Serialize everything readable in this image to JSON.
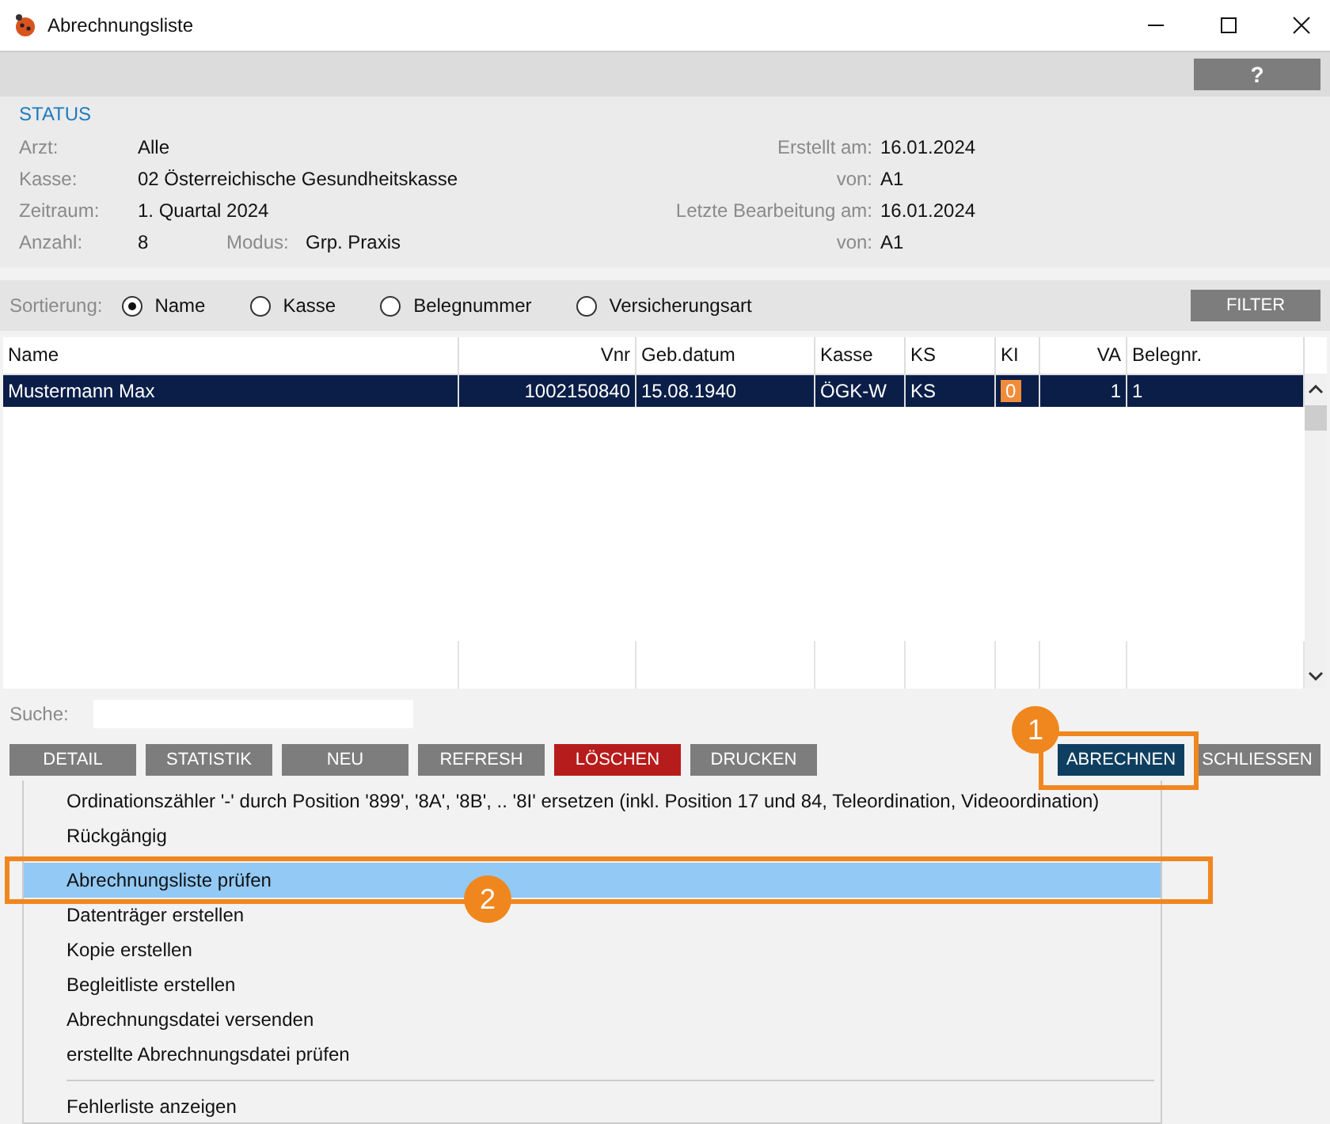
{
  "window": {
    "title": "Abrechnungsliste"
  },
  "help_button": "?",
  "status": {
    "heading": "STATUS",
    "rows": [
      {
        "label": "Arzt:",
        "value": "Alle",
        "right_label": "Erstellt am:",
        "right_value": "16.01.2024"
      },
      {
        "label": "Kasse:",
        "value": "02  Österreichische Gesundheitskasse",
        "right_label": "von:",
        "right_value": "A1"
      },
      {
        "label": "Zeitraum:",
        "value": "1. Quartal 2024",
        "right_label": "Letzte Bearbeitung am:",
        "right_value": "16.01.2024"
      },
      {
        "label": "Anzahl:",
        "value": "8",
        "extra_label": "Modus:",
        "extra_value": "Grp. Praxis",
        "right_label": "von:",
        "right_value": "A1"
      }
    ]
  },
  "sorting": {
    "label": "Sortierung:",
    "options": [
      {
        "label": "Name",
        "selected": true
      },
      {
        "label": "Kasse",
        "selected": false
      },
      {
        "label": "Belegnummer",
        "selected": false
      },
      {
        "label": "Versicherungsart",
        "selected": false
      }
    ]
  },
  "filter_button": "FILTER",
  "table": {
    "columns": [
      {
        "label": "Name",
        "kind": "text"
      },
      {
        "label": "Vnr",
        "kind": "number"
      },
      {
        "label": "Geb.datum",
        "kind": "text"
      },
      {
        "label": "Kasse",
        "kind": "text"
      },
      {
        "label": "KS",
        "kind": "text"
      },
      {
        "label": "KI",
        "kind": "badge"
      },
      {
        "label": "VA",
        "kind": "number"
      },
      {
        "label": "Belegnr.",
        "kind": "text"
      }
    ],
    "rows": [
      {
        "selected": true,
        "cells": [
          "Mustermann Max",
          "1002150840",
          "15.08.1940",
          "ÖGK-W",
          "KS",
          "0",
          "1",
          "1"
        ]
      }
    ]
  },
  "search": {
    "label": "Suche:"
  },
  "buttons": [
    {
      "label": "DETAIL",
      "kind": "normal"
    },
    {
      "label": "STATISTIK",
      "kind": "normal"
    },
    {
      "label": "NEU",
      "kind": "normal"
    },
    {
      "label": "REFRESH",
      "kind": "normal"
    },
    {
      "label": "LÖSCHEN",
      "kind": "danger"
    },
    {
      "label": "DRUCKEN",
      "kind": "normal"
    }
  ],
  "right_buttons": [
    {
      "label": "ABRECHNEN",
      "kind": "primary"
    },
    {
      "label": "SCHLIESSEN",
      "kind": "normal"
    }
  ],
  "menu": {
    "groups": [
      [
        {
          "label": "Ordinationszähler '-' durch Position '899', '8A', '8B', .. '8I' ersetzen  (inkl. Position 17 und 84, Teleordination, Videoordination)",
          "selected": false
        },
        {
          "label": "Rückgängig",
          "selected": false
        }
      ],
      [
        {
          "label": "Abrechnungsliste prüfen",
          "selected": true
        },
        {
          "label": "Datenträger erstellen",
          "selected": false
        },
        {
          "label": "Kopie erstellen",
          "selected": false
        },
        {
          "label": "Begleitliste erstellen",
          "selected": false
        },
        {
          "label": "Abrechnungsdatei versenden",
          "selected": false
        },
        {
          "label": "erstellte Abrechnungsdatei prüfen",
          "selected": false
        }
      ],
      [
        {
          "label": "Fehlerliste anzeigen",
          "selected": false
        }
      ]
    ]
  },
  "annotations": [
    {
      "label": "1"
    },
    {
      "label": "2"
    }
  ]
}
